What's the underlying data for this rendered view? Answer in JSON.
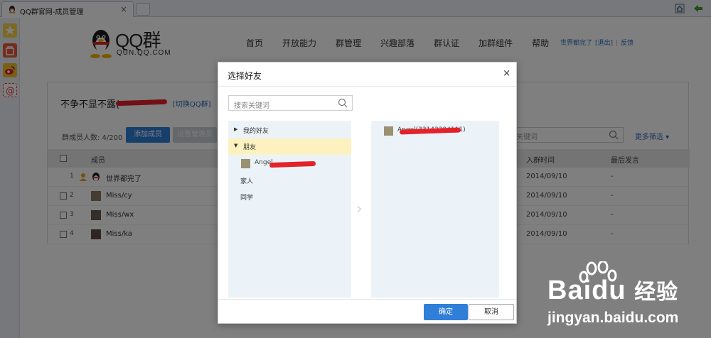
{
  "browser": {
    "tab_title": "QQ群官网-成员管理",
    "tab_close": "×"
  },
  "site": {
    "brand": "QQ群",
    "domain": "QUN.QQ.COM",
    "nav": [
      "首页",
      "开放能力",
      "群管理",
      "兴趣部落",
      "群认证",
      "加群组件",
      "帮助"
    ],
    "user_name": "世界都完了",
    "logout": "[退出]",
    "feedback": "反馈"
  },
  "panel": {
    "group_name": "不争不显不露(",
    "switch_group": "[切换QQ群]",
    "member_count": "群成员人数: 4/200",
    "add_member": "添加成员",
    "set_admin": "设置管理员",
    "search_placeholder": "关键词",
    "more_filter": "更多筛选 ▾",
    "columns": {
      "member": "成员",
      "join_time": "入群时间",
      "last_speak": "最后发言"
    },
    "rows": [
      {
        "index": "1",
        "name": "世界都完了",
        "date": "2014/09/10",
        "last": "-"
      },
      {
        "index": "2",
        "name": "Miss/cy",
        "date": "2014/09/10",
        "last": "-"
      },
      {
        "index": "3",
        "name": "Miss/wx",
        "date": "2014/09/10",
        "last": "-"
      },
      {
        "index": "4",
        "name": "Miss/ka",
        "date": "2014/09/10",
        "last": "-"
      }
    ]
  },
  "dialog": {
    "title": "选择好友",
    "close": "×",
    "search_placeholder": "搜索关键词",
    "tree": {
      "my_friends": "我的好友",
      "friends": "朋友",
      "friend_item": "Angel",
      "family": "家人",
      "classmates": "同学"
    },
    "selected_item": "Angel(33143384111)",
    "ok": "确定",
    "cancel": "取消"
  },
  "watermark": {
    "brand_latin": "Bai",
    "brand_du": "du",
    "brand_cn": "经验",
    "url": "jingyan.baidu.com"
  },
  "colors": {
    "primary": "#2f7ed8",
    "link": "#2a6bbf",
    "tree_bg": "#ecf3f8",
    "tree_selected": "#fdf2bf",
    "redaction": "#e3232a"
  }
}
